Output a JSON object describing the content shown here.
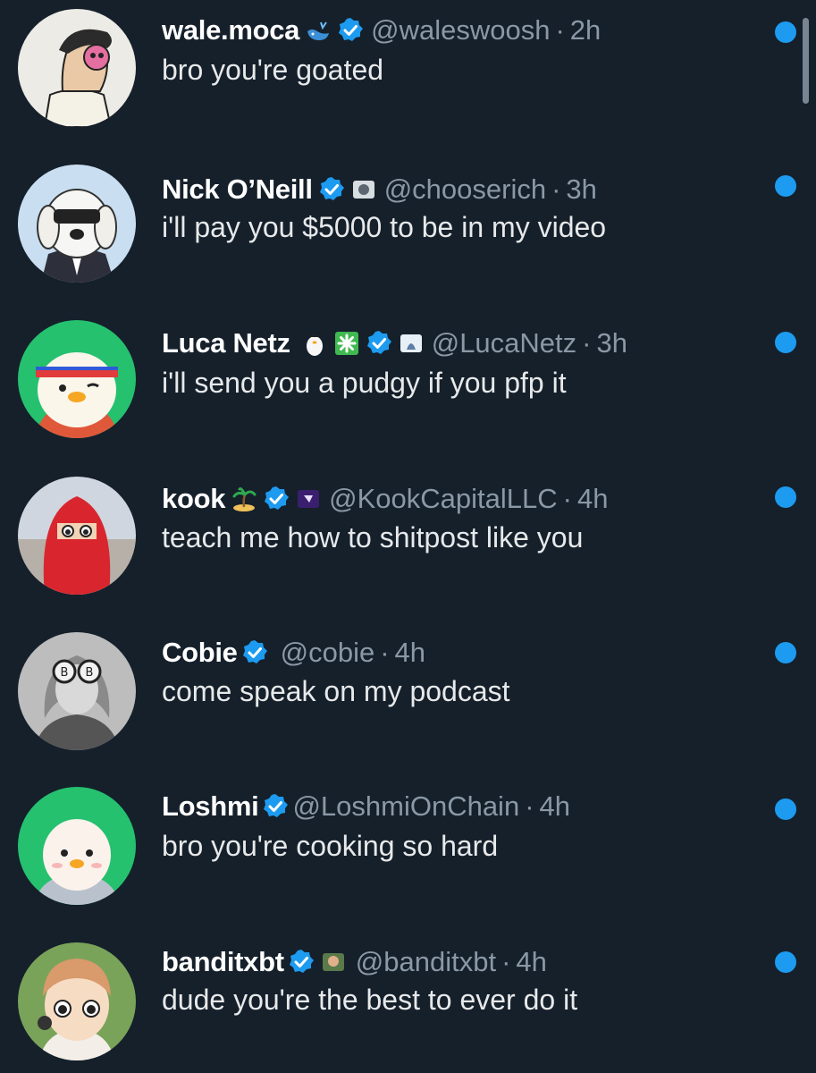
{
  "theme": {
    "background": "#15202b",
    "text_primary": "#e7e9ea",
    "text_secondary": "#8b98a5",
    "unread_dot": "#1d9bf0",
    "verified": "#1d9bf0"
  },
  "messages": [
    {
      "name": "wale.moca",
      "badges": [
        "whale-emoji-icon",
        "verified-badge-icon"
      ],
      "handle": "@waleswoosh",
      "separator": "·",
      "time": "2h",
      "text": "bro you're goated",
      "unread": true,
      "avatar": "wale-moca-avatar"
    },
    {
      "name": "Nick O’Neill",
      "badges": [
        "verified-badge-icon",
        "affiliate-badge-icon"
      ],
      "handle": "@chooserich",
      "separator": "·",
      "time": "3h",
      "text": "i'll pay you $5000 to be in my video",
      "unread": true,
      "avatar": "nick-oneill-avatar"
    },
    {
      "name": "Luca Netz",
      "badges": [
        "penguin-emoji-icon",
        "sparkle-emoji-icon",
        "verified-badge-icon",
        "affiliate-badge-icon"
      ],
      "handle": "@LucaNetz",
      "separator": "·",
      "time": "3h",
      "text": "i'll send you a pudgy if you pfp it",
      "unread": true,
      "avatar": "luca-netz-avatar"
    },
    {
      "name": "kook",
      "badges": [
        "island-emoji-icon",
        "verified-badge-icon",
        "affiliate-badge-icon"
      ],
      "handle": "@KookCapitalLLC",
      "separator": "·",
      "time": "4h",
      "text": "teach me how to shitpost like you",
      "unread": true,
      "avatar": "kook-avatar"
    },
    {
      "name": "Cobie",
      "badges": [
        "verified-badge-icon"
      ],
      "handle": "@cobie",
      "separator": "·",
      "time": "4h",
      "text": "come speak on my podcast",
      "unread": true,
      "avatar": "cobie-avatar"
    },
    {
      "name": "Loshmi",
      "badges": [
        "verified-badge-icon"
      ],
      "handle": "@LoshmiOnChain",
      "separator": "·",
      "time": "4h",
      "text": "bro you're cooking so hard",
      "unread": true,
      "avatar": "loshmi-avatar"
    },
    {
      "name": "banditxbt",
      "badges": [
        "verified-badge-icon",
        "affiliate-badge-icon"
      ],
      "handle": "@banditxbt",
      "separator": "·",
      "time": "4h",
      "text": "dude you're the best to ever do it",
      "unread": true,
      "avatar": "banditxbt-avatar"
    }
  ]
}
